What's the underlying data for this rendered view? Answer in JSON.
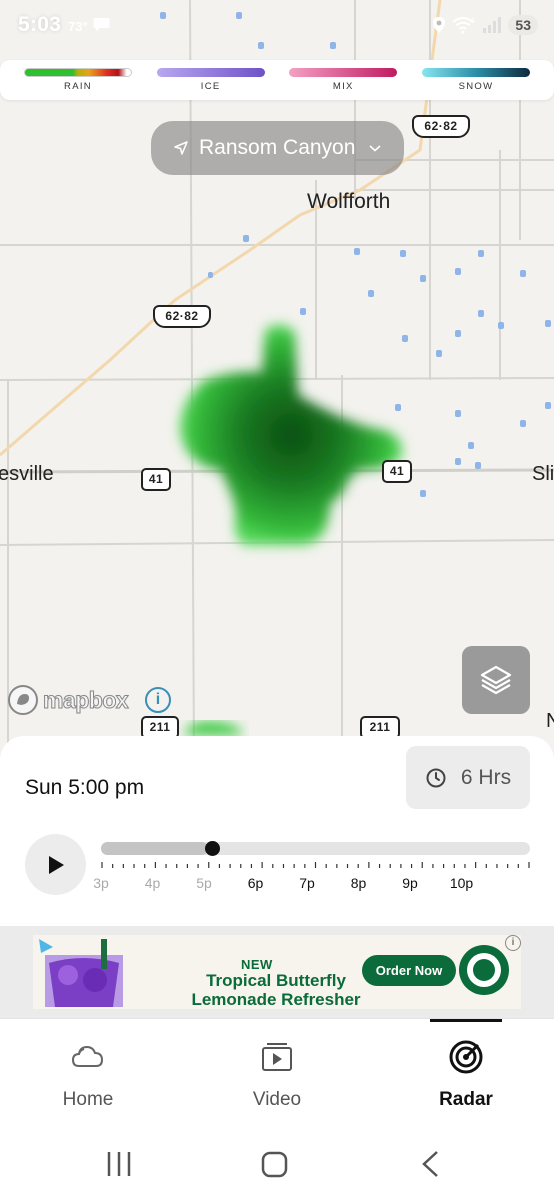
{
  "status_bar": {
    "time": "5:03",
    "temperature": "73°",
    "battery": "53",
    "network": "6"
  },
  "legend": {
    "items": [
      {
        "label": "RAIN",
        "color_start": "#2fbf2f",
        "color_end": "#ffffff"
      },
      {
        "label": "ICE",
        "color_start": "#b8a7f0",
        "color_end": "#6e52c7"
      },
      {
        "label": "MIX",
        "color_start": "#f4a0c4",
        "color_end": "#c01a61"
      },
      {
        "label": "SNOW",
        "color_start": "#86e5ef",
        "color_end": "#102a3d"
      }
    ]
  },
  "location": {
    "name": "Ransom Canyon",
    "icon": "location-arrow-icon"
  },
  "map": {
    "places": {
      "wolfforth": "Wolfforth",
      "left_edge": "esville",
      "right_edge": "Sli",
      "far_right": "N"
    },
    "shields": {
      "us_top": "62·82",
      "us_mid": "62·82",
      "route41_left": "41",
      "route41_right": "41",
      "route211_left": "211",
      "route211_right": "211"
    },
    "attribution": "mapbox",
    "info_symbol": "i",
    "radar_color": "#2fbf2f"
  },
  "timeline": {
    "current_time": "Sun 5:00 pm",
    "duration": "6 Hrs",
    "progress": 0.25,
    "tick_labels": [
      "3p",
      "4p",
      "5p",
      "6p",
      "7p",
      "8p",
      "9p",
      "10p"
    ],
    "past_count": 3
  },
  "ad": {
    "new_label": "NEW",
    "headline": "Tropical Butterfly Lemonade Refresher",
    "cta": "Order Now",
    "info": "i",
    "brand_color": "#0b6b3a"
  },
  "bottom_nav": {
    "items": [
      {
        "label": "Home",
        "icon": "cloud-icon"
      },
      {
        "label": "Video",
        "icon": "video-icon"
      },
      {
        "label": "Radar",
        "icon": "radar-icon"
      }
    ],
    "active": "Radar"
  }
}
